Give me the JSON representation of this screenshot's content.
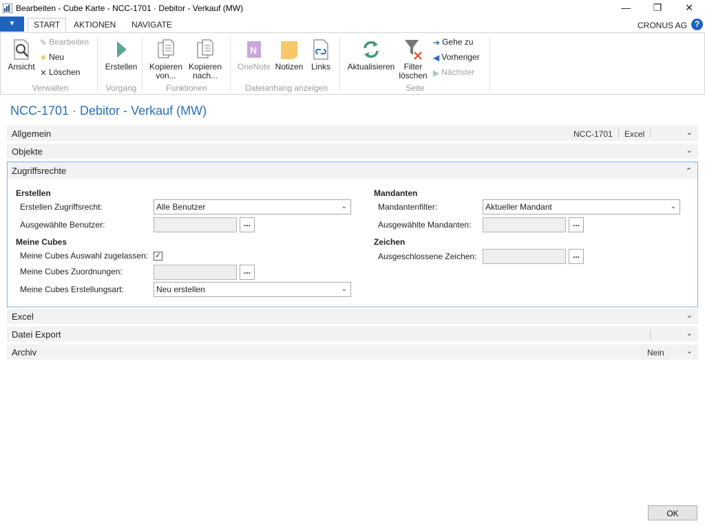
{
  "window": {
    "title": "Bearbeiten - Cube Karte - NCC-1701 · Debitor - Verkauf (MW)",
    "minimize": "—",
    "restore": "❐",
    "close": "✕"
  },
  "menu": {
    "file_icon": "▼",
    "tabs": [
      "START",
      "AKTIONEN",
      "NAVIGATE"
    ],
    "company": "CRONUS AG",
    "help": "?"
  },
  "ribbon": {
    "ansicht": "Ansicht",
    "bearbeiten": "Bearbeiten",
    "neu": "Neu",
    "loeschen": "Löschen",
    "erstellen": "Erstellen",
    "kopieren_von_1": "Kopieren",
    "kopieren_von_2": "von...",
    "kopieren_nach_1": "Kopieren",
    "kopieren_nach_2": "nach...",
    "onenote": "OneNote",
    "notizen": "Notizen",
    "links": "Links",
    "aktualisieren": "Aktualisieren",
    "filter_1": "Filter",
    "filter_2": "löschen",
    "gehe_zu": "Gehe zu",
    "vorheriger": "Vorheriger",
    "naechster": "Nächster",
    "groups": {
      "verwalten": "Verwalten",
      "vorgang": "Vorgang",
      "funktionen": "Funktionen",
      "dateianhang": "Dateianhang anzeigen",
      "seite": "Seite"
    }
  },
  "page_title": "NCC-1701 · Debitor - Verkauf (MW)",
  "fasttabs": {
    "allgemein": {
      "title": "Allgemein",
      "value1": "NCC-1701",
      "value2": "Excel"
    },
    "objekte": {
      "title": "Objekte"
    },
    "zugriffsrechte": {
      "title": "Zugriffsrechte"
    },
    "excel": {
      "title": "Excel"
    },
    "datei_export": {
      "title": "Datei Export"
    },
    "archiv": {
      "title": "Archiv",
      "value": "Nein"
    }
  },
  "zugriff": {
    "erstellen_header": "Erstellen",
    "erstellen_zugriffsrecht_label": "Erstellen Zugriffsrecht:",
    "erstellen_zugriffsrecht_value": "Alle Benutzer",
    "ausgewaehlte_benutzer_label": "Ausgewählte Benutzer:",
    "meine_cubes_header": "Meine Cubes",
    "auswahl_label": "Meine Cubes Auswahl zugelassen:",
    "auswahl_checked": "✓",
    "zuordnungen_label": "Meine Cubes Zuordnungen:",
    "erstellungsart_label": "Meine Cubes Erstellungsart:",
    "erstellungsart_value": "Neu erstellen",
    "mandanten_header": "Mandanten",
    "mandantenfilter_label": "Mandantenfilter:",
    "mandantenfilter_value": "Aktueller Mandant",
    "ausgewaehlte_mandanten_label": "Ausgewählte Mandanten:",
    "zeichen_header": "Zeichen",
    "ausgeschlossene_zeichen_label": "Ausgeschlossene Zeichen:",
    "ellipsis": "..."
  },
  "chevrons": {
    "down": "⌄",
    "up": "⌃"
  },
  "ok_button": "OK"
}
